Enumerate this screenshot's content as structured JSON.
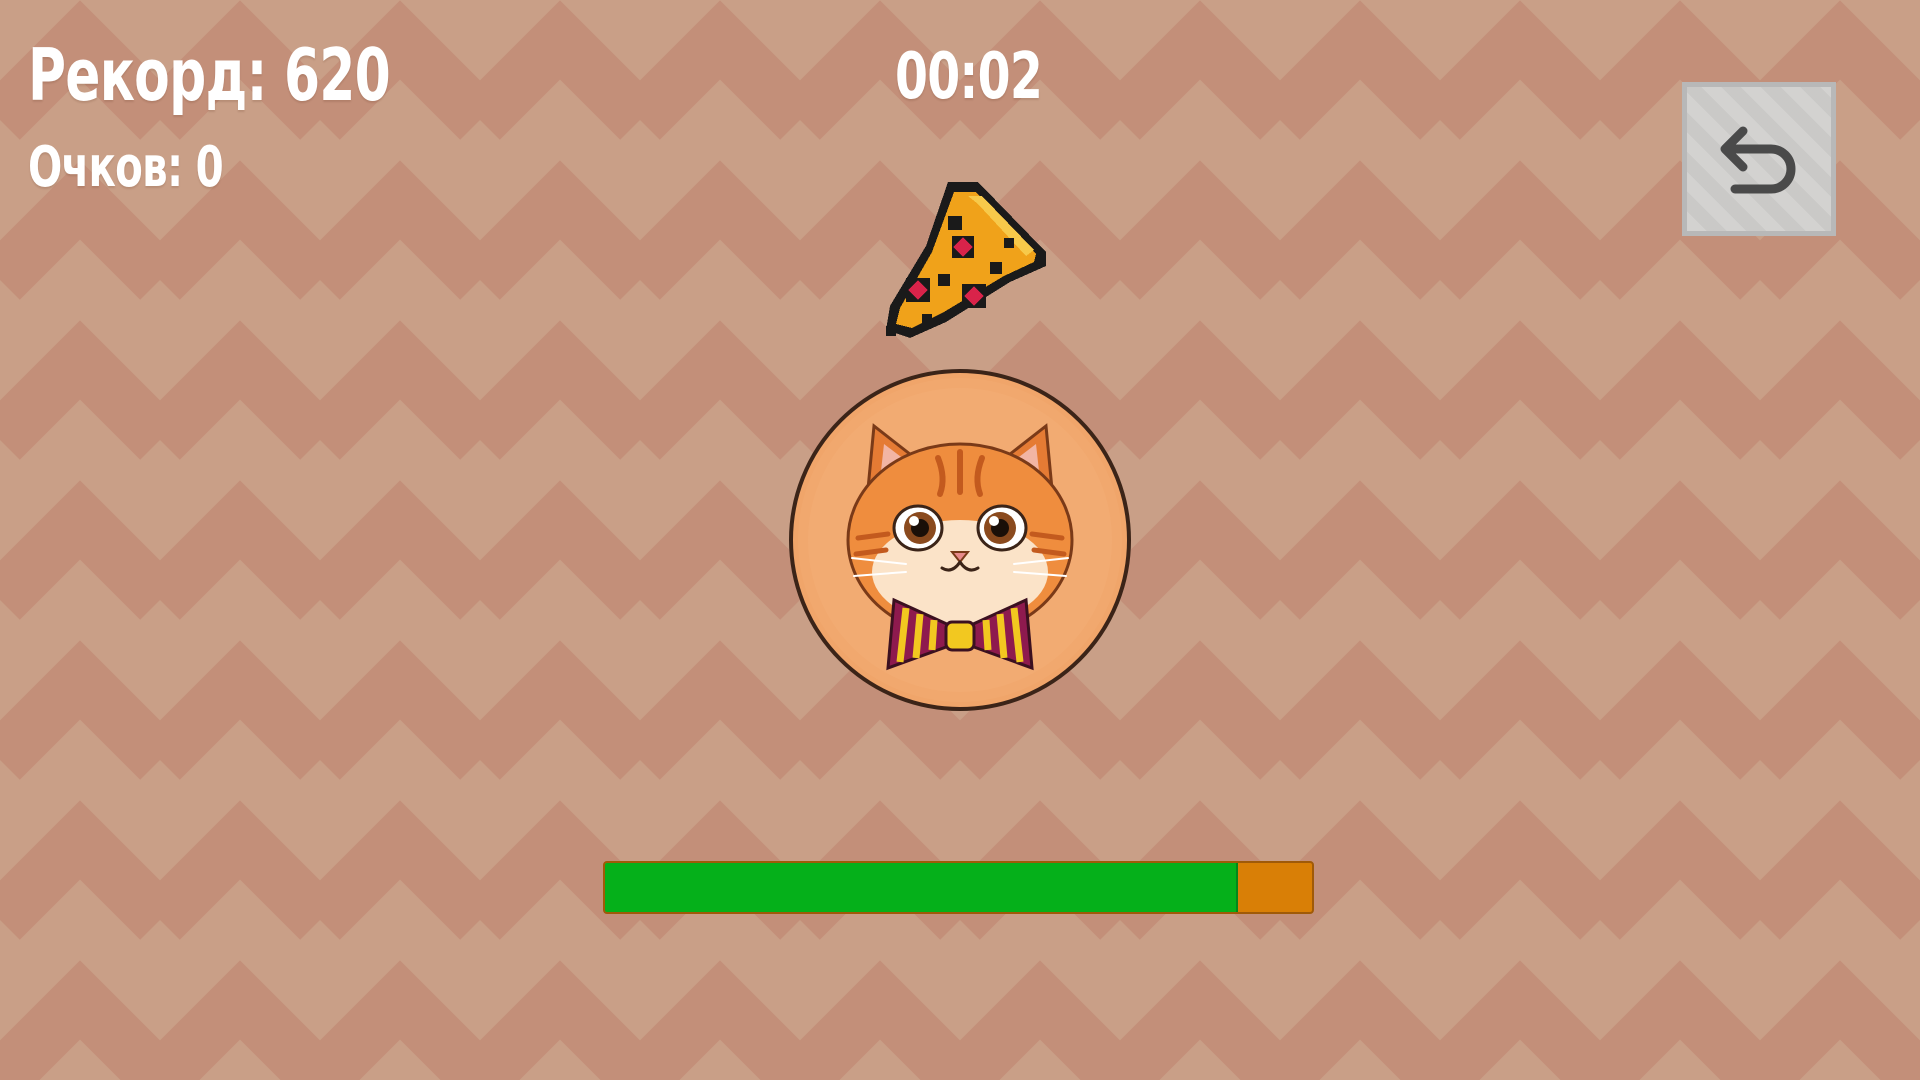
{
  "hud": {
    "record_label": "Рекорд: 620",
    "score_label": "Очков: 0",
    "timer": "00:02"
  },
  "back_button": {
    "icon": "undo-arrow-icon"
  },
  "falling_item": {
    "icon": "pizza-slice-icon"
  },
  "player": {
    "icon": "cat-with-bowtie-icon"
  },
  "progress": {
    "fraction": 0.895
  },
  "colors": {
    "background": "#c99f87",
    "chevron": "#c48e78",
    "progress_fill": "#05b01a",
    "progress_remaining": "#d97f06",
    "hud_text": "#ffffff"
  }
}
